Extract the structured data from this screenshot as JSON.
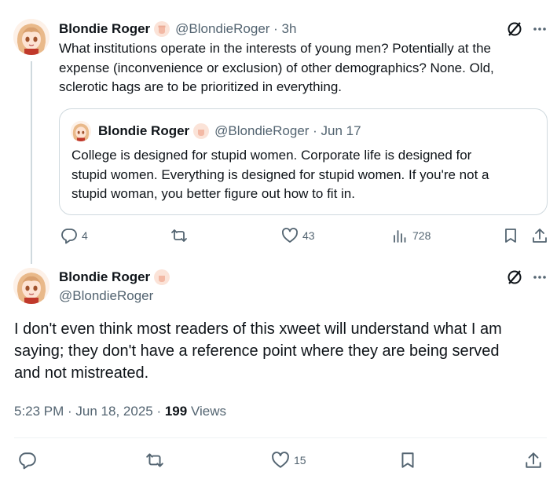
{
  "colors": {
    "text": "#0f1419",
    "muted": "#536471",
    "border": "#cfd9de",
    "badge": "#f7d4c6"
  },
  "icons": [
    "clenched-fist-badge",
    "grok-icon",
    "more-icon",
    "reply-icon",
    "retweet-icon",
    "like-icon",
    "views-icon",
    "bookmark-icon",
    "share-icon"
  ],
  "parent_tweet": {
    "name": "Blondie Roger",
    "handle_time": "@BlondieRoger · 3h",
    "text_lines": [
      "What institutions operate in the interests of young men? Potentially at the",
      "expense (inconvenience or exclusion) of other demographics? None. Old,",
      "sclerotic hags are to be prioritized in everything."
    ],
    "quote": {
      "name": "Blondie Roger",
      "handle_time": "@BlondieRoger · Jun 17",
      "text_lines": [
        "College is designed for stupid women. Corporate life is designed for",
        "stupid women. Everything is designed for stupid women. If you're not a",
        "stupid woman, you better figure out how to fit in."
      ]
    },
    "stats": {
      "replies": "4",
      "likes": "43",
      "views": "728"
    }
  },
  "main_tweet": {
    "name": "Blondie Roger",
    "handle": "@BlondieRoger",
    "text_lines": [
      "I don't even think most readers of this xweet will understand what I am",
      "saying; they don't have a reference point where they are being served",
      "and not mistreated."
    ],
    "timestamp": "5:23 PM · Jun 18, 2025",
    "separator": " · ",
    "views_count": "199",
    "views_label": " Views",
    "likes": "15"
  }
}
